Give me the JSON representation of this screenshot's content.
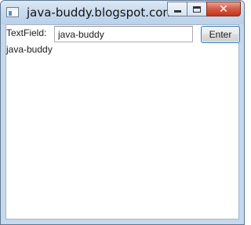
{
  "window": {
    "title": "java-buddy.blogspot.com",
    "icon": "java-window-icon",
    "buttons": {
      "minimize_icon": "minimize-icon",
      "maximize_icon": "maximize-icon",
      "close_glyph": "✕"
    }
  },
  "form": {
    "textfield_label": "TextField:",
    "textfield_value": "java-buddy",
    "enter_label": "Enter",
    "output_text": "java-buddy"
  },
  "colors": {
    "titlebar": "#c7daee",
    "close_button": "#c1371c",
    "button_focus_border": "#3c7fb1",
    "background": "#ffffff"
  }
}
